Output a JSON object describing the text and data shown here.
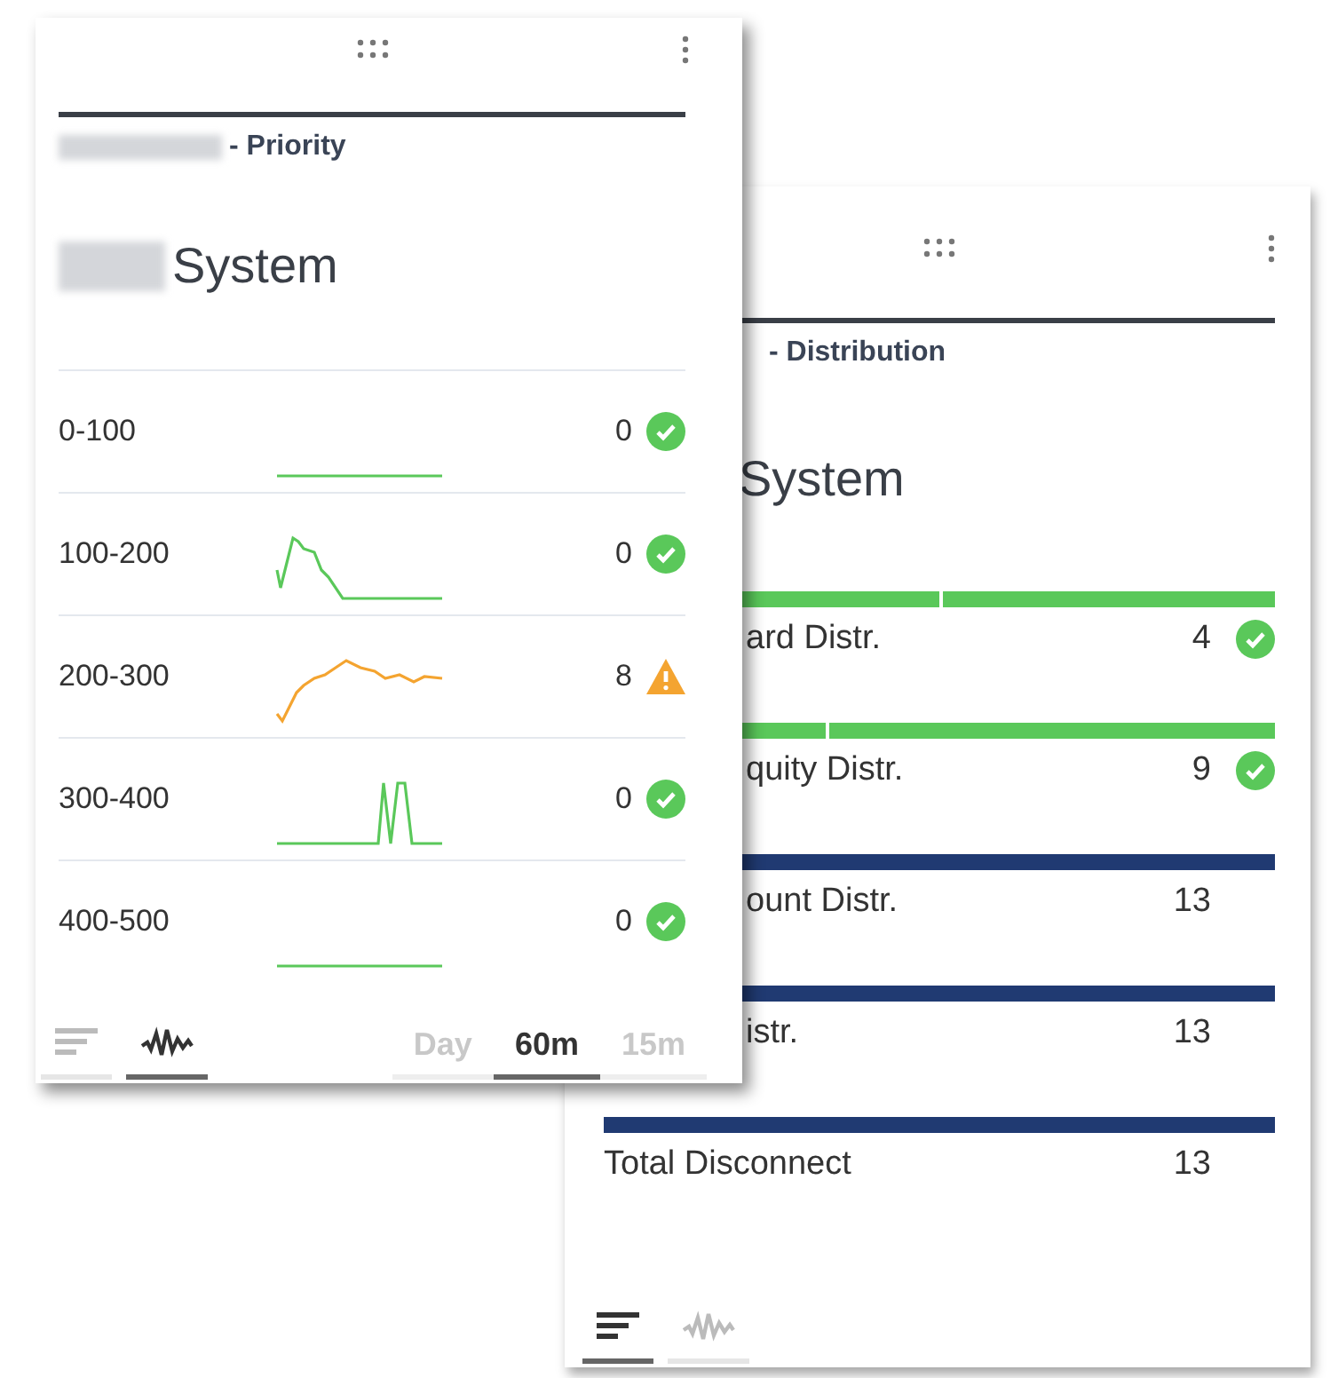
{
  "cards": [
    {
      "subtitle": {
        "text": "- Distribution",
        "cut": true
      },
      "title": {
        "text": "System",
        "cut": true
      },
      "rows": [
        {
          "kind": "bar",
          "label": "ard Distr.",
          "cut": true,
          "count": "4",
          "status": {
            "kind": "check"
          },
          "bar": {
            "color": "#5ac85a",
            "segments": [
              {
                "level": 0.5
              },
              {
                "level": 0.5
              }
            ]
          }
        },
        {
          "kind": "bar",
          "label": "quity Distr.",
          "cut": true,
          "count": "9",
          "status": {
            "kind": "check"
          },
          "bar": {
            "color": "#5ac85a",
            "segments": [
              {
                "level": 0.33
              },
              {
                "level": 0.67
              }
            ]
          }
        },
        {
          "kind": "bar",
          "label": "ount Distr.",
          "cut": true,
          "count": "13",
          "bar": {
            "color": "#203a72"
          }
        },
        {
          "kind": "bar",
          "label": "istr.",
          "cut": true,
          "count": "13",
          "bar": {
            "color": "#203a72"
          }
        },
        {
          "kind": "bar",
          "label": "Total Disconnect",
          "count": "13",
          "bar": {
            "color": "#203a72"
          }
        }
      ],
      "views": [
        {
          "kind": "list",
          "selected": true
        },
        {
          "kind": "wave",
          "selected": false
        }
      ]
    },
    {
      "subtitle": {
        "text": "- Priority",
        "redacted": true
      },
      "title": {
        "text": "System",
        "redacted": true
      },
      "rows": [
        {
          "kind": "spark",
          "label": "0-100",
          "sparkline": {
            "kind": "flat"
          },
          "count": "0",
          "status": {
            "kind": "check"
          }
        },
        {
          "kind": "spark",
          "label": "100-200",
          "sparkline": {
            "kind": "spike"
          },
          "count": "0",
          "status": {
            "kind": "check"
          }
        },
        {
          "kind": "spark",
          "label": "200-300",
          "sparkline": {
            "kind": "rise"
          },
          "count": "8",
          "status": {
            "kind": "warning"
          }
        },
        {
          "kind": "spark",
          "label": "300-400",
          "sparkline": {
            "kind": "pulse"
          },
          "count": "0",
          "status": {
            "kind": "check"
          }
        },
        {
          "kind": "spark",
          "label": "400-500",
          "sparkline": {
            "kind": "flat"
          },
          "count": "0",
          "status": {
            "kind": "check"
          }
        }
      ],
      "views": [
        {
          "kind": "list",
          "selected": false
        },
        {
          "kind": "wave",
          "selected": true
        }
      ],
      "ranges": [
        {
          "label": "Day",
          "selected": false
        },
        {
          "label": "60m",
          "selected": true
        },
        {
          "label": "15m",
          "selected": false
        }
      ]
    }
  ]
}
